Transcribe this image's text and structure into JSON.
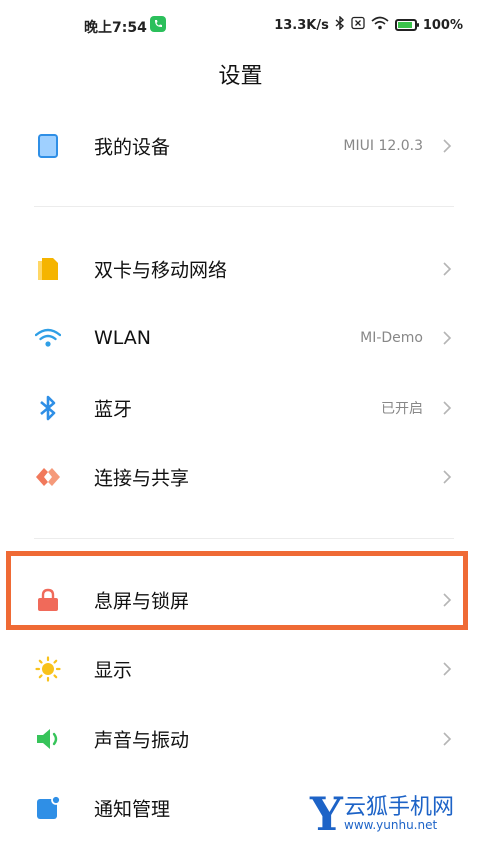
{
  "status_bar": {
    "time": "晚上7:54",
    "speed": "13.3K/s",
    "battery": "100%",
    "battery_level_percent": 100,
    "icons": [
      "phone-call-icon",
      "bluetooth-icon",
      "sim-disabled-icon",
      "wifi-icon",
      "battery-icon"
    ]
  },
  "header": {
    "title": "设置"
  },
  "groups": [
    {
      "items": [
        {
          "label": "我的设备",
          "value": "MIUI 12.0.3",
          "icon": "device-icon",
          "icon_color": "#2f8fe6"
        }
      ]
    },
    {
      "items": [
        {
          "label": "双卡与移动网络",
          "value": "",
          "icon": "sim-card-icon",
          "icon_color": "#f5b400"
        },
        {
          "label": "WLAN",
          "value": "MI-Demo",
          "icon": "wifi-icon",
          "icon_color": "#2f9fe6"
        },
        {
          "label": "蓝牙",
          "value": "已开启",
          "icon": "bluetooth-icon",
          "icon_color": "#2f8fe6"
        },
        {
          "label": "连接与共享",
          "value": "",
          "icon": "connection-share-icon",
          "icon_color": "#ef6a4a"
        }
      ]
    },
    {
      "items": [
        {
          "label": "息屏与锁屏",
          "value": "",
          "icon": "lock-icon",
          "icon_color": "#f06a5a",
          "highlighted": true
        },
        {
          "label": "显示",
          "value": "",
          "icon": "sun-icon",
          "icon_color": "#f8c21b"
        },
        {
          "label": "声音与振动",
          "value": "",
          "icon": "speaker-icon",
          "icon_color": "#37c45a"
        },
        {
          "label": "通知管理",
          "value": "",
          "icon": "notification-icon",
          "icon_color": "#2f8fe6"
        }
      ]
    }
  ],
  "highlight_color": "#ef6a35",
  "watermark": {
    "letter": "Y",
    "name": "云狐手机网",
    "url": "www.yunhu.net"
  }
}
